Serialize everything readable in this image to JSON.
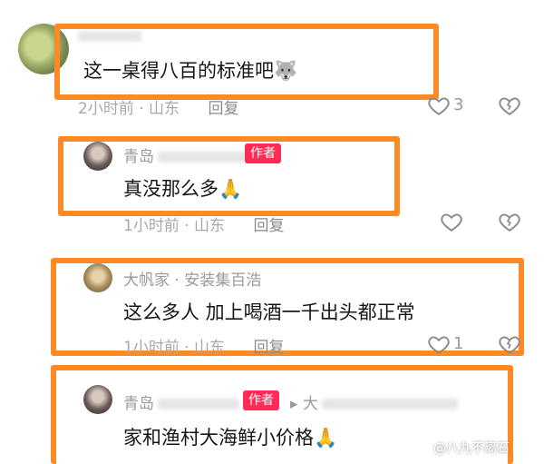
{
  "comments": [
    {
      "name": "",
      "is_author": false,
      "text": "这一桌得八百的标准吧",
      "emoji": "🐺",
      "time": "2小时前",
      "location": "山东",
      "reply": "回复",
      "likes": "3"
    },
    {
      "name": "青岛",
      "is_author": true,
      "author_badge": "作者",
      "text": "真没那么多",
      "emoji": "🙏",
      "time": "1小时前",
      "location": "山东",
      "reply": "回复",
      "likes": ""
    },
    {
      "name": "大帆家",
      "name_suffix": "安装集百浩",
      "is_author": false,
      "text": "这么多人 加上喝酒一千出头都正常",
      "emoji": "",
      "time": "1小时前",
      "location": "山东",
      "reply": "回复",
      "likes": "1"
    },
    {
      "name": "青岛",
      "is_author": true,
      "author_badge": "作者",
      "reply_to_arrow": "▸",
      "reply_to": "大",
      "text": "家和渔村大海鲜小价格",
      "emoji": "🙏",
      "time": "",
      "location": "",
      "reply": "",
      "likes": ""
    }
  ],
  "icons": {
    "like": "heart-outline-icon",
    "dislike": "broken-heart-icon"
  },
  "colors": {
    "highlight_box": "#ff8a24",
    "author_badge": "#fe2c55"
  },
  "watermark": "@八九不离石"
}
